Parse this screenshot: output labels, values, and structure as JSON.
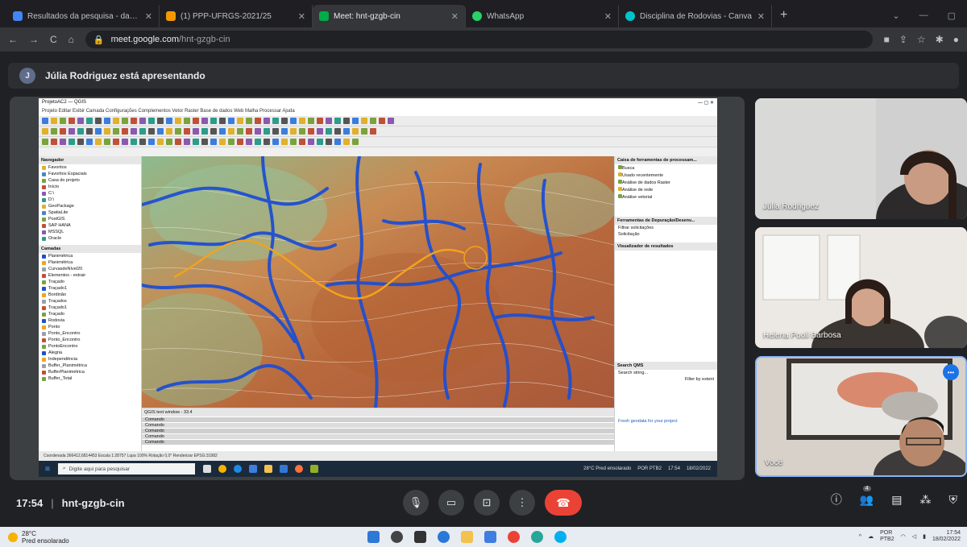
{
  "browser": {
    "tabs": [
      {
        "title": "Resultados da pesquisa - daniel...",
        "fav": "#4285f4",
        "active": false
      },
      {
        "title": "(1) PPP-UFRGS-2021/25",
        "fav": "#f29900",
        "active": false
      },
      {
        "title": "Meet: hnt-gzgb-cin",
        "fav": "#00ac47",
        "active": true
      },
      {
        "title": "WhatsApp",
        "fav": "#25d366",
        "active": false
      },
      {
        "title": "Disciplina de Rodovias - Canva",
        "fav": "#00c4cc",
        "active": false
      }
    ],
    "url_host": "meet.google.com",
    "url_path": "/hnt-gzgb-cin"
  },
  "presenter": {
    "initial": "J",
    "text": "Júlia Rodriguez está apresentando"
  },
  "qgis": {
    "title": "ProjetoAC2 — QGIS",
    "menu": "Projeto  Editar  Exibir  Camada  Configurações  Complementos  Vetor  Raster  Base de dados  Web  Malha  Processar  Ajuda",
    "browser_header": "Navegador",
    "browser_items": [
      "Favoritos",
      "Favoritos Espaciais",
      "Casa do projeto",
      "Início",
      "C:\\",
      "D:\\",
      "GeoPackage",
      "SpatiaLite",
      "PostGIS",
      "SAP HANA",
      "MSSQL",
      "Oracle"
    ],
    "layers_header": "Camadas",
    "layers": [
      "Planimétrica",
      "Planimétrica",
      "CurvasdeNível20",
      "Elementos - extrair",
      "Traçado",
      "Traçado1",
      "Bordinão",
      "Traçados",
      "Traçado1",
      "Traçado",
      "Rodovia",
      "Ponto",
      "Ponto_Encontro",
      "Ponto_Encontro",
      "PontoEncontro",
      "Alegria",
      "Independência",
      "Buffer_Planimétrica",
      "BufferPlanimétrica",
      "Buffer_Total"
    ],
    "processing_header": "Caixa de ferramentas de processam...",
    "processing_items": [
      "Busca",
      "Usado recentemente",
      "Análise de dados Raster",
      "Análise de rede",
      "Análise vetorial"
    ],
    "debug_header": "Ferramentas de Depuração/Desenv...",
    "debug_filter": "Filtrar solicitações",
    "debug_request": "Solicitação",
    "results_header": "Visualizador de resultados",
    "search_header": "Search QMS",
    "search_placeholder": "Search string...",
    "search_filter": "Filter by extent",
    "console_header": "QGIS text window - 33.4",
    "console_lines": [
      "Comando",
      "Comando",
      "Comando",
      "Comando",
      "Comando"
    ],
    "fresh_link": "Fresh geodata for your project",
    "status_text": "Coordenada 366412,6814453   Escala 1:28757   Lupa 100%   Rotação 0,0°   Renderizar   EPSG:31982",
    "taskbar_search": "Digite aqui para pesquisar",
    "weather": "28°C  Pred ensolarado",
    "tray_lang": "POR PTB2",
    "tray_time": "17:54",
    "tray_date": "18/02/2022"
  },
  "participants": [
    {
      "name": "Júlia Rodriguez"
    },
    {
      "name": "Helena Pooli Barbosa"
    },
    {
      "name": "Você"
    }
  ],
  "meeting": {
    "time": "17:54",
    "code": "hnt-gzgb-cin",
    "people_count": "4"
  },
  "windows": {
    "temp": "28°C",
    "weather": "Pred ensolarado",
    "lang": "POR",
    "lang2": "PTB2",
    "time": "17:54",
    "date": "18/02/2022"
  },
  "colors": {
    "end_call": "#ea4335",
    "accent": "#8ab4f8",
    "river": "#1f4fd1",
    "road": "#f2a31b"
  }
}
